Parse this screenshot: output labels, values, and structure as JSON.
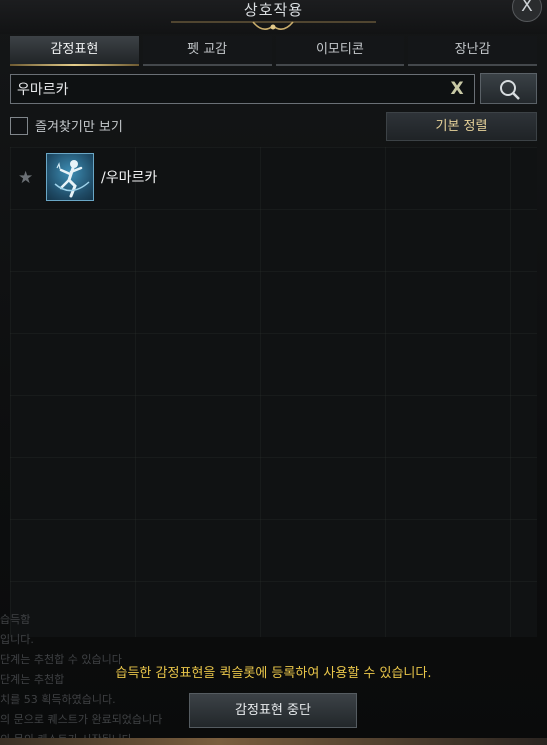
{
  "window": {
    "title": "상호작용",
    "close_label": "X"
  },
  "tabs": [
    {
      "label": "감정표현",
      "active": true
    },
    {
      "label": "펫 교감",
      "active": false
    },
    {
      "label": "이모티콘",
      "active": false
    },
    {
      "label": "장난감",
      "active": false
    }
  ],
  "search": {
    "value": "우마르카",
    "clear_label": "X",
    "icon": "search-icon"
  },
  "filters": {
    "favorites_only_label": "즐겨찾기만 보기",
    "favorites_only_checked": false,
    "sort_label": "기본 정렬"
  },
  "list": {
    "items": [
      {
        "name": "/우마르카",
        "favorite": false,
        "icon": "dance-emote-icon",
        "star": "★"
      }
    ]
  },
  "background_chat": [
    "습득함",
    "입니다.",
    "단계는 추천합 수 있습니다",
    "단계는 추천합",
    "치를 53 획득하였습니다.",
    "의 문으로 퀘스트가 완료되었습니다",
    "의 문의 퀘스트가 시작됩니다."
  ],
  "footer": {
    "notice": "습득한 감정표현을 퀵슬롯에 등록하여 사용할 수 있습니다.",
    "stop_button_label": "감정표현 중단"
  },
  "colors": {
    "accent_gold": "#e9c64a",
    "tab_active_underline": "#e6cf8c",
    "icon_blue": "#3e8fb6"
  }
}
